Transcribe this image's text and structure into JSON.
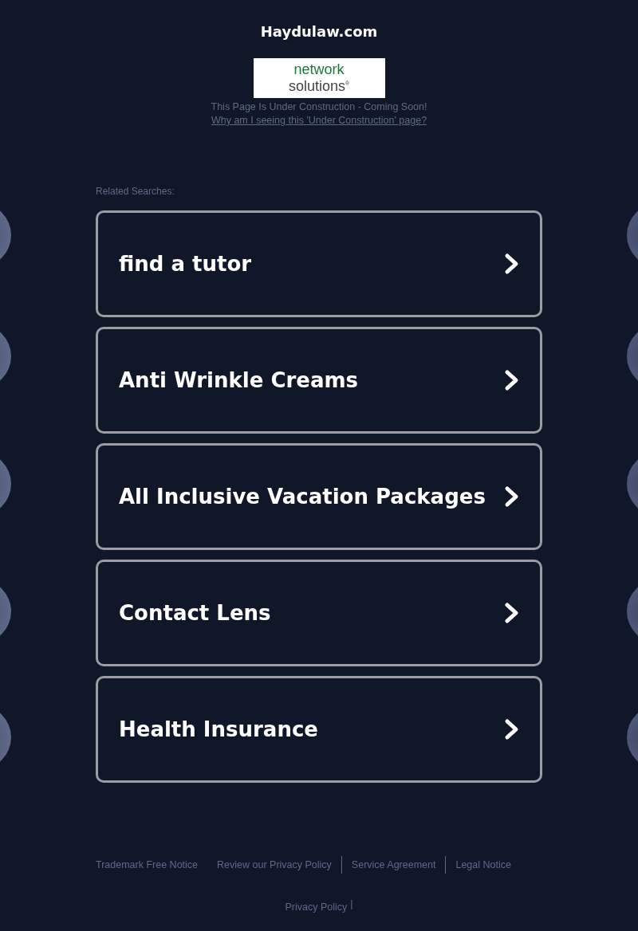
{
  "header": {
    "title": "Haydulaw.com",
    "logo": {
      "line_1": "network",
      "line_2": "solutions",
      "mark": "®"
    },
    "notice": "This Page Is Under Construction - Coming Soon!",
    "link": "Why am I seeing this 'Under Construction' page?"
  },
  "related": {
    "label": "Related Searches:",
    "items": [
      {
        "text": "find a tutor"
      },
      {
        "text": "Anti Wrinkle Creams"
      },
      {
        "text": "All Inclusive Vacation Packages"
      },
      {
        "text": "Contact Lens"
      },
      {
        "text": "Health Insurance"
      }
    ]
  },
  "footer": {
    "links": [
      "Trademark Free Notice",
      "Review our Privacy Policy",
      "Service Agreement",
      "Legal Notice"
    ],
    "privacy": "Privacy Policy",
    "privacy_separator": "|"
  }
}
